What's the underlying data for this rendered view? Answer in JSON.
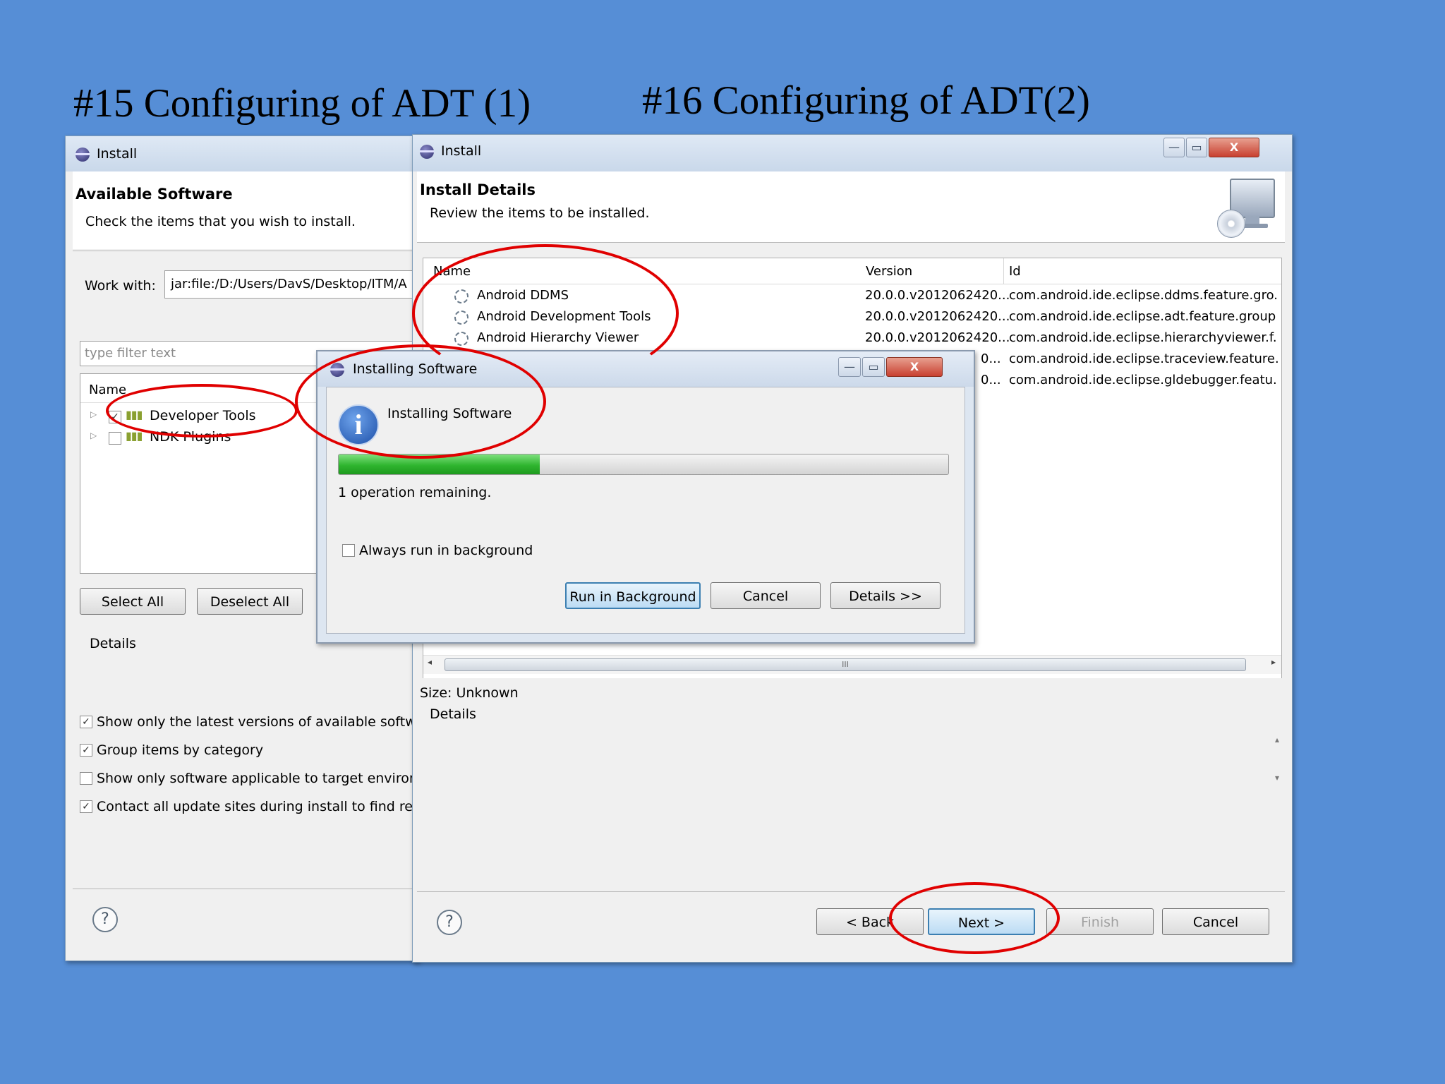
{
  "slide": {
    "title_left": "#15 Configuring of ADT (1)",
    "title_right": "#16 Configuring of ADT(2)"
  },
  "install_left": {
    "window_title": "Install",
    "header_title": "Available Software",
    "header_subtitle": "Check the items that you wish to install.",
    "work_with_label": "Work with:",
    "work_with_value": "jar:file:/D:/Users/DavS/Desktop/ITM/A",
    "filter_placeholder": "type filter text",
    "col_name": "Name",
    "tree_items": [
      {
        "label": "Developer Tools",
        "checked": true
      },
      {
        "label": "NDK Plugins",
        "checked": false
      }
    ],
    "select_all": "Select All",
    "deselect_all": "Deselect All",
    "details_label": "Details",
    "options": [
      {
        "label": "Show only the latest versions of available software",
        "checked": true
      },
      {
        "label": "Group items by category",
        "checked": true
      },
      {
        "label": "Show only software applicable to target environm",
        "checked": false
      },
      {
        "label": "Contact all update sites during install to find requ",
        "checked": true
      }
    ],
    "help_icon": "?"
  },
  "install_right": {
    "window_title": "Install",
    "header_title": "Install Details",
    "header_subtitle": "Review the items to be installed.",
    "columns": [
      "Name",
      "Version",
      "Id"
    ],
    "rows": [
      {
        "name": "Android DDMS",
        "version": "20.0.0.v2012062420...",
        "id": "com.android.ide.eclipse.ddms.feature.gro."
      },
      {
        "name": "Android Development Tools",
        "version": "20.0.0.v2012062420...",
        "id": "com.android.ide.eclipse.adt.feature.group"
      },
      {
        "name": "Android Hierarchy Viewer",
        "version": "20.0.0.v2012062420...",
        "id": "com.android.ide.eclipse.hierarchyviewer.f."
      },
      {
        "name": "",
        "version": "0...",
        "id": "com.android.ide.eclipse.traceview.feature."
      },
      {
        "name": "",
        "version": "0...",
        "id": "com.android.ide.eclipse.gldebugger.featu."
      }
    ],
    "scroll_thumb_glyph": "III",
    "size_label": "Size: Unknown",
    "details_label": "Details",
    "buttons": {
      "back": "< Back",
      "next": "Next >",
      "finish": "Finish",
      "cancel": "Cancel"
    },
    "window_controls": {
      "minimize": "—",
      "maximize": "▭",
      "close": "X"
    },
    "help_icon": "?"
  },
  "installing_dialog": {
    "window_title": "Installing Software",
    "message": "Installing Software",
    "progress": 0.33,
    "status": "1 operation remaining.",
    "always_background_label": "Always run in background",
    "always_background_checked": false,
    "buttons": {
      "run_background": "Run in Background",
      "cancel": "Cancel",
      "details": "Details >>"
    },
    "window_controls": {
      "minimize": "—",
      "maximize": "▭",
      "close": "X"
    },
    "info_icon": "i"
  },
  "colors": {
    "background": "#568ed6",
    "annotation_red": "#e00000",
    "progress_green": "#2fb52f"
  }
}
